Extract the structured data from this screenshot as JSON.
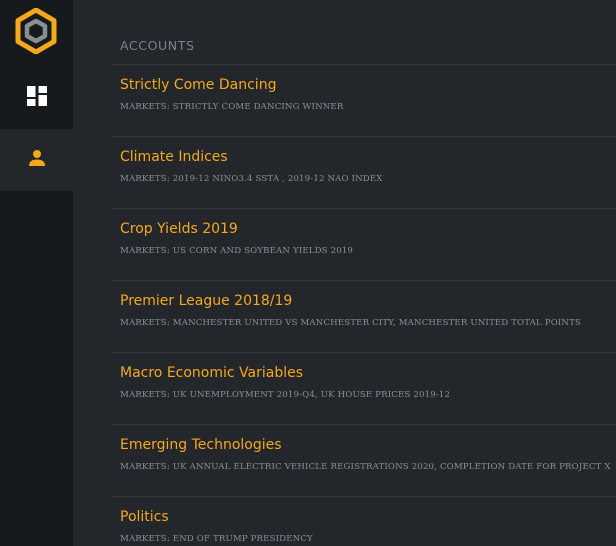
{
  "colors": {
    "accent": "#f5a91a",
    "sidebar_bg": "#171a1d",
    "main_bg": "#23272c",
    "muted_text": "#8c9198"
  },
  "sidebar": {
    "logo_icon": "hexagon-logo-icon",
    "items": [
      {
        "icon": "dashboard-icon",
        "active": false
      },
      {
        "icon": "user-icon",
        "active": true
      }
    ]
  },
  "main": {
    "section_title": "ACCOUNTS",
    "accounts": [
      {
        "name": "Strictly Come Dancing",
        "markets": "MARKETS: STRICTLY COME DANCING WINNER"
      },
      {
        "name": "Climate Indices",
        "markets": "MARKETS: 2019-12 NINO3.4 SSTA , 2019-12 NAO INDEX"
      },
      {
        "name": "Crop Yields 2019",
        "markets": "MARKETS: US CORN AND SOYBEAN YIELDS 2019"
      },
      {
        "name": "Premier League 2018/19",
        "markets": "MARKETS: MANCHESTER UNITED VS MANCHESTER CITY, MANCHESTER UNITED TOTAL POINTS"
      },
      {
        "name": "Macro Economic Variables",
        "markets": "MARKETS: UK UNEMPLOYMENT 2019-Q4, UK HOUSE PRICES 2019-12"
      },
      {
        "name": "Emerging Technologies",
        "markets": "MARKETS: UK ANNUAL ELECTRIC VEHICLE REGISTRATIONS 2020, COMPLETION DATE FOR PROJECT X"
      },
      {
        "name": "Politics",
        "markets": "MARKETS: END OF TRUMP PRESIDENCY"
      }
    ]
  }
}
